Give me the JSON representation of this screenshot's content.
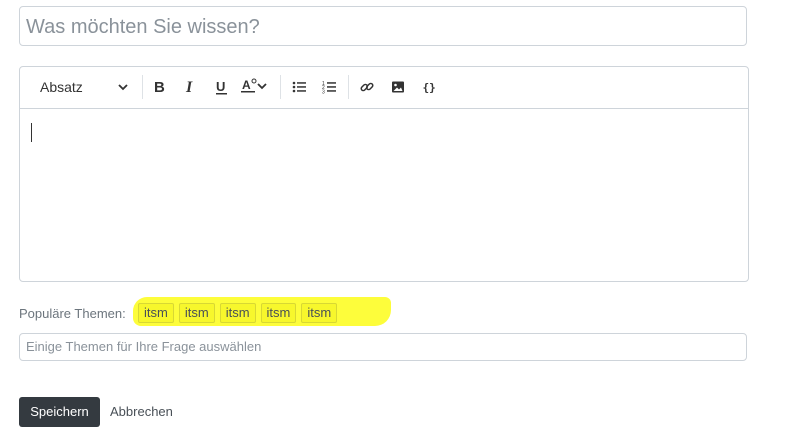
{
  "question": {
    "placeholder": "Was möchten Sie wissen?"
  },
  "toolbar": {
    "format_label": "Absatz",
    "icons": [
      "bold-icon",
      "italic-icon",
      "underline-icon",
      "text-style-icon",
      "bulleted-list-icon",
      "numbered-list-icon",
      "link-icon",
      "image-icon",
      "code-block-icon"
    ]
  },
  "popular": {
    "label": "Populäre Themen:",
    "topics": [
      "itsm",
      "itsm",
      "itsm",
      "itsm",
      "itsm"
    ]
  },
  "topic_field": {
    "placeholder": "Einige Themen für Ihre Frage auswählen"
  },
  "actions": {
    "save_label": "Speichern",
    "cancel_label": "Abbrechen"
  }
}
